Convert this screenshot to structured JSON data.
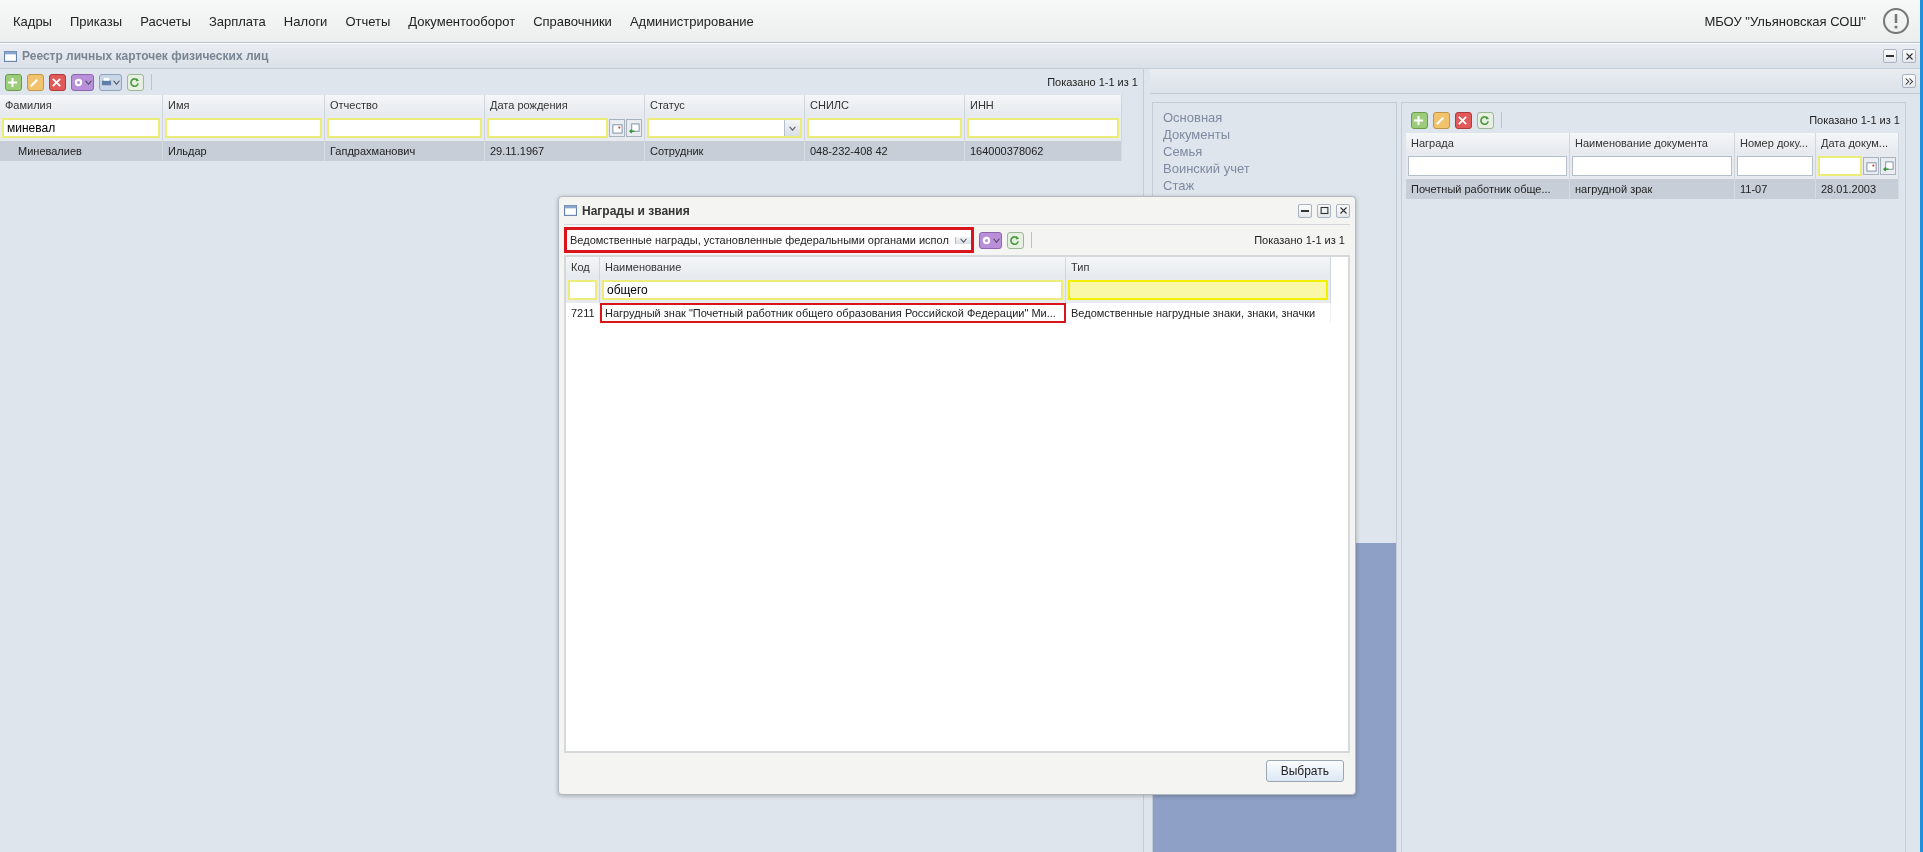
{
  "menu": {
    "items": [
      {
        "label": "Кадры"
      },
      {
        "label": "Приказы"
      },
      {
        "label": "Расчеты"
      },
      {
        "label": "Зарплата"
      },
      {
        "label": "Налоги"
      },
      {
        "label": "Отчеты"
      },
      {
        "label": "Документооборот"
      },
      {
        "label": "Справочники"
      },
      {
        "label": "Администрирование"
      }
    ],
    "organization": "МБОУ \"Ульяновская СОШ\""
  },
  "window": {
    "title": "Реестр личных карточек физических лиц"
  },
  "registry": {
    "status": "Показано 1-1 из 1",
    "columns": [
      {
        "label": "Фамилия",
        "kind": "text",
        "filter": "миневал"
      },
      {
        "label": "Имя",
        "kind": "text"
      },
      {
        "label": "Отчество",
        "kind": "text"
      },
      {
        "label": "Дата рождения",
        "kind": "date"
      },
      {
        "label": "Статус",
        "kind": "select"
      },
      {
        "label": "СНИЛС",
        "kind": "text"
      },
      {
        "label": "ИНН",
        "kind": "text"
      }
    ],
    "rows": [
      {
        "selected": true,
        "cells": [
          "Миневалиев",
          "Ильдар",
          "Гапдрахманович",
          "29.11.1967",
          "Сотрудник",
          "048-232-408 42",
          "164000378062"
        ]
      }
    ]
  },
  "details": {
    "nav": [
      {
        "label": "Основная"
      },
      {
        "label": "Документы"
      },
      {
        "label": "Семья"
      },
      {
        "label": "Воинский учет"
      },
      {
        "label": "Стаж"
      }
    ],
    "awards": {
      "status": "Показано 1-1 из 1",
      "columns": [
        {
          "label": "Награда",
          "kind": "plain"
        },
        {
          "label": "Наименование документа",
          "kind": "plain"
        },
        {
          "label": "Номер доку...",
          "kind": "plain"
        },
        {
          "label": "Дата докум...",
          "kind": "date"
        }
      ],
      "rows": [
        {
          "selected": true,
          "cells": [
            "Почетный работник обще...",
            "нагрудной зрак",
            "11-07",
            "28.01.2003"
          ]
        }
      ]
    }
  },
  "dialog": {
    "title": "Награды и звания",
    "category": {
      "value": "Ведомственные награды, установленные федеральными органами испол",
      "highlighted": true
    },
    "status": "Показано 1-1 из 1",
    "columns": [
      {
        "label": "Код",
        "kind": "text"
      },
      {
        "label": "Наименование",
        "kind": "text",
        "filter": "общего"
      },
      {
        "label": "Тип",
        "kind": "shaded"
      }
    ],
    "rows": [
      {
        "selected": false,
        "cells": [
          {
            "text": "7211",
            "highlighted": false
          },
          {
            "text": "Нагрудный знак \"Почетный работник общего образования Российской Федерации\" Ми...",
            "highlighted": true
          },
          {
            "text": "Ведомственные нагрудные знаки, знаки, значки",
            "highlighted": false
          }
        ]
      }
    ],
    "buttons": [
      {
        "label": "Выбрать"
      }
    ]
  }
}
